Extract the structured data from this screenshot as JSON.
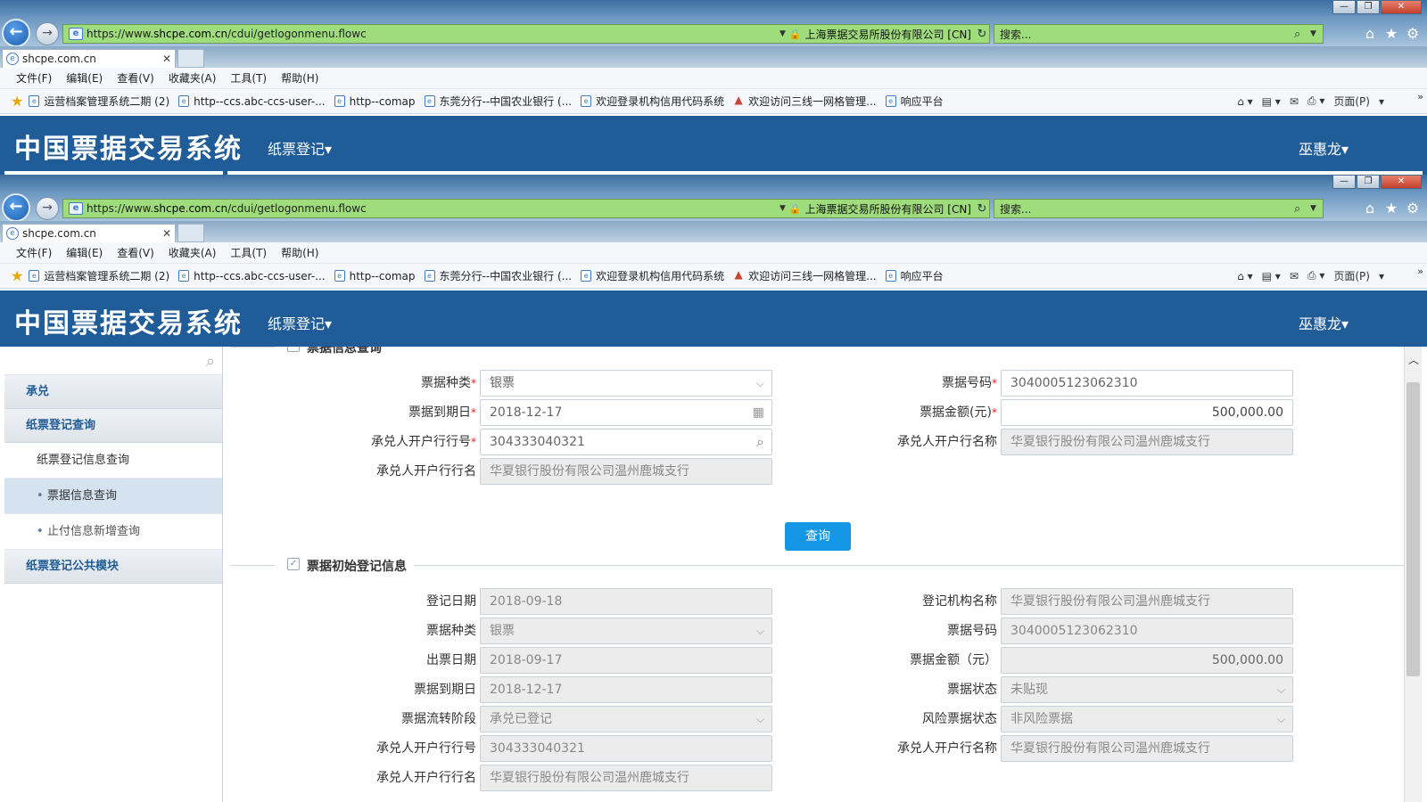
{
  "browser": {
    "url_prefix": "https://www.",
    "url_host": "shcpe.com.cn",
    "url_path": "/cdui/getlogonmenu.flowc",
    "cert_label": "上海票据交易所股份有限公司 [CN]",
    "search_placeholder": "搜索...",
    "tab_title": "shcpe.com.cn",
    "menu": [
      "文件(F)",
      "编辑(E)",
      "查看(V)",
      "收藏夹(A)",
      "工具(T)",
      "帮助(H)"
    ],
    "favorites": [
      "运营档案管理系统二期 (2)",
      "http--ccs.abc-ccs-user-...",
      "http--comap",
      "东莞分行--中国农业银行 (...",
      "欢迎登录机构信用代码系统",
      "欢迎访问三线一网格管理...",
      "响应平台"
    ],
    "page_menu": "页面(P)"
  },
  "app": {
    "title": "中国票据交易系统",
    "module": "纸票登记",
    "user": "巫惠龙"
  },
  "sidebar": {
    "groups": [
      {
        "label": "承兑"
      },
      {
        "label": "纸票登记查询"
      },
      {
        "label": "纸票登记公共模块"
      }
    ],
    "sub": "纸票登记信息查询",
    "leaves": [
      "票据信息查询",
      "止付信息新增查询"
    ]
  },
  "query": {
    "section_title": "票据信息查询",
    "bill_type_label": "票据种类",
    "bill_type": "银票",
    "bill_no_label": "票据号码",
    "bill_no": "3040005123062310",
    "due_date_label": "票据到期日",
    "due_date": "2018-12-17",
    "amount_label": "票据金额(元)",
    "amount": "500,000.00",
    "acceptor_bank_no_label": "承兑人开户行行号",
    "acceptor_bank_no": "304333040321",
    "acceptor_bank_name_label": "承兑人开户行名称",
    "acceptor_bank_name": "华夏银行股份有限公司温州鹿城支行",
    "acceptor_bank_name2_label": "承兑人开户行行名",
    "acceptor_bank_name2": "华夏银行股份有限公司温州鹿城支行",
    "query_button": "查询"
  },
  "initial": {
    "section_title": "票据初始登记信息",
    "reg_date_label": "登记日期",
    "reg_date": "2018-09-18",
    "reg_org_label": "登记机构名称",
    "reg_org": "华夏银行股份有限公司温州鹿城支行",
    "bill_type_label": "票据种类",
    "bill_type": "银票",
    "bill_no_label": "票据号码",
    "bill_no": "3040005123062310",
    "issue_date_label": "出票日期",
    "issue_date": "2018-09-17",
    "amount_label": "票据金额（元）",
    "amount": "500,000.00",
    "due_date_label": "票据到期日",
    "due_date": "2018-12-17",
    "status_label": "票据状态",
    "status": "未贴现",
    "stage_label": "票据流转阶段",
    "stage": "承兑已登记",
    "risk_label": "风险票据状态",
    "risk": "非风险票据",
    "acceptor_bank_no_label": "承兑人开户行行号",
    "acceptor_bank_no": "304333040321",
    "acceptor_bank_name_label": "承兑人开户行名称",
    "acceptor_bank_name": "华夏银行股份有限公司温州鹿城支行",
    "acceptor_bank_name2_label": "承兑人开户行行名",
    "acceptor_bank_name2": "华夏银行股份有限公司温州鹿城支行"
  }
}
